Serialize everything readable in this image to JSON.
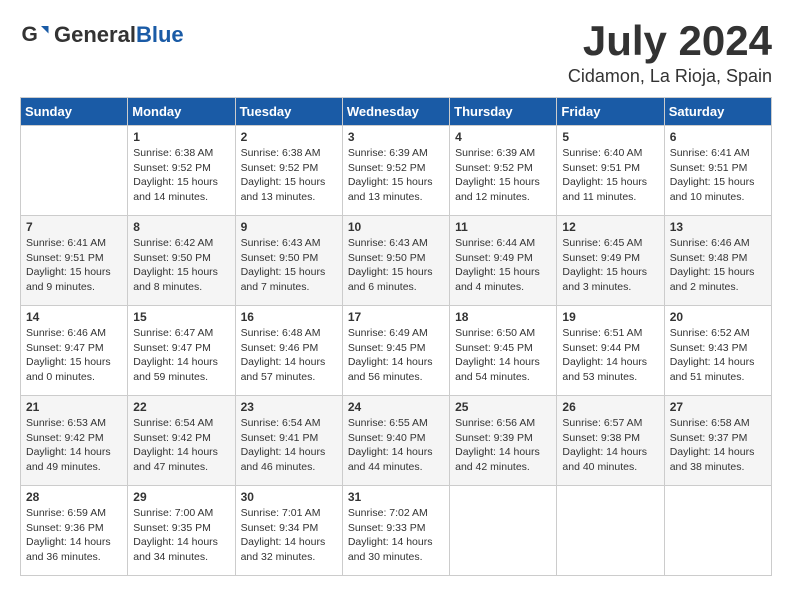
{
  "header": {
    "logo_general": "General",
    "logo_blue": "Blue",
    "month_year": "July 2024",
    "location": "Cidamon, La Rioja, Spain"
  },
  "days_of_week": [
    "Sunday",
    "Monday",
    "Tuesday",
    "Wednesday",
    "Thursday",
    "Friday",
    "Saturday"
  ],
  "weeks": [
    [
      {
        "day": "",
        "sunrise": "",
        "sunset": "",
        "daylight": ""
      },
      {
        "day": "1",
        "sunrise": "Sunrise: 6:38 AM",
        "sunset": "Sunset: 9:52 PM",
        "daylight": "Daylight: 15 hours and 14 minutes."
      },
      {
        "day": "2",
        "sunrise": "Sunrise: 6:38 AM",
        "sunset": "Sunset: 9:52 PM",
        "daylight": "Daylight: 15 hours and 13 minutes."
      },
      {
        "day": "3",
        "sunrise": "Sunrise: 6:39 AM",
        "sunset": "Sunset: 9:52 PM",
        "daylight": "Daylight: 15 hours and 13 minutes."
      },
      {
        "day": "4",
        "sunrise": "Sunrise: 6:39 AM",
        "sunset": "Sunset: 9:52 PM",
        "daylight": "Daylight: 15 hours and 12 minutes."
      },
      {
        "day": "5",
        "sunrise": "Sunrise: 6:40 AM",
        "sunset": "Sunset: 9:51 PM",
        "daylight": "Daylight: 15 hours and 11 minutes."
      },
      {
        "day": "6",
        "sunrise": "Sunrise: 6:41 AM",
        "sunset": "Sunset: 9:51 PM",
        "daylight": "Daylight: 15 hours and 10 minutes."
      }
    ],
    [
      {
        "day": "7",
        "sunrise": "Sunrise: 6:41 AM",
        "sunset": "Sunset: 9:51 PM",
        "daylight": "Daylight: 15 hours and 9 minutes."
      },
      {
        "day": "8",
        "sunrise": "Sunrise: 6:42 AM",
        "sunset": "Sunset: 9:50 PM",
        "daylight": "Daylight: 15 hours and 8 minutes."
      },
      {
        "day": "9",
        "sunrise": "Sunrise: 6:43 AM",
        "sunset": "Sunset: 9:50 PM",
        "daylight": "Daylight: 15 hours and 7 minutes."
      },
      {
        "day": "10",
        "sunrise": "Sunrise: 6:43 AM",
        "sunset": "Sunset: 9:50 PM",
        "daylight": "Daylight: 15 hours and 6 minutes."
      },
      {
        "day": "11",
        "sunrise": "Sunrise: 6:44 AM",
        "sunset": "Sunset: 9:49 PM",
        "daylight": "Daylight: 15 hours and 4 minutes."
      },
      {
        "day": "12",
        "sunrise": "Sunrise: 6:45 AM",
        "sunset": "Sunset: 9:49 PM",
        "daylight": "Daylight: 15 hours and 3 minutes."
      },
      {
        "day": "13",
        "sunrise": "Sunrise: 6:46 AM",
        "sunset": "Sunset: 9:48 PM",
        "daylight": "Daylight: 15 hours and 2 minutes."
      }
    ],
    [
      {
        "day": "14",
        "sunrise": "Sunrise: 6:46 AM",
        "sunset": "Sunset: 9:47 PM",
        "daylight": "Daylight: 15 hours and 0 minutes."
      },
      {
        "day": "15",
        "sunrise": "Sunrise: 6:47 AM",
        "sunset": "Sunset: 9:47 PM",
        "daylight": "Daylight: 14 hours and 59 minutes."
      },
      {
        "day": "16",
        "sunrise": "Sunrise: 6:48 AM",
        "sunset": "Sunset: 9:46 PM",
        "daylight": "Daylight: 14 hours and 57 minutes."
      },
      {
        "day": "17",
        "sunrise": "Sunrise: 6:49 AM",
        "sunset": "Sunset: 9:45 PM",
        "daylight": "Daylight: 14 hours and 56 minutes."
      },
      {
        "day": "18",
        "sunrise": "Sunrise: 6:50 AM",
        "sunset": "Sunset: 9:45 PM",
        "daylight": "Daylight: 14 hours and 54 minutes."
      },
      {
        "day": "19",
        "sunrise": "Sunrise: 6:51 AM",
        "sunset": "Sunset: 9:44 PM",
        "daylight": "Daylight: 14 hours and 53 minutes."
      },
      {
        "day": "20",
        "sunrise": "Sunrise: 6:52 AM",
        "sunset": "Sunset: 9:43 PM",
        "daylight": "Daylight: 14 hours and 51 minutes."
      }
    ],
    [
      {
        "day": "21",
        "sunrise": "Sunrise: 6:53 AM",
        "sunset": "Sunset: 9:42 PM",
        "daylight": "Daylight: 14 hours and 49 minutes."
      },
      {
        "day": "22",
        "sunrise": "Sunrise: 6:54 AM",
        "sunset": "Sunset: 9:42 PM",
        "daylight": "Daylight: 14 hours and 47 minutes."
      },
      {
        "day": "23",
        "sunrise": "Sunrise: 6:54 AM",
        "sunset": "Sunset: 9:41 PM",
        "daylight": "Daylight: 14 hours and 46 minutes."
      },
      {
        "day": "24",
        "sunrise": "Sunrise: 6:55 AM",
        "sunset": "Sunset: 9:40 PM",
        "daylight": "Daylight: 14 hours and 44 minutes."
      },
      {
        "day": "25",
        "sunrise": "Sunrise: 6:56 AM",
        "sunset": "Sunset: 9:39 PM",
        "daylight": "Daylight: 14 hours and 42 minutes."
      },
      {
        "day": "26",
        "sunrise": "Sunrise: 6:57 AM",
        "sunset": "Sunset: 9:38 PM",
        "daylight": "Daylight: 14 hours and 40 minutes."
      },
      {
        "day": "27",
        "sunrise": "Sunrise: 6:58 AM",
        "sunset": "Sunset: 9:37 PM",
        "daylight": "Daylight: 14 hours and 38 minutes."
      }
    ],
    [
      {
        "day": "28",
        "sunrise": "Sunrise: 6:59 AM",
        "sunset": "Sunset: 9:36 PM",
        "daylight": "Daylight: 14 hours and 36 minutes."
      },
      {
        "day": "29",
        "sunrise": "Sunrise: 7:00 AM",
        "sunset": "Sunset: 9:35 PM",
        "daylight": "Daylight: 14 hours and 34 minutes."
      },
      {
        "day": "30",
        "sunrise": "Sunrise: 7:01 AM",
        "sunset": "Sunset: 9:34 PM",
        "daylight": "Daylight: 14 hours and 32 minutes."
      },
      {
        "day": "31",
        "sunrise": "Sunrise: 7:02 AM",
        "sunset": "Sunset: 9:33 PM",
        "daylight": "Daylight: 14 hours and 30 minutes."
      },
      {
        "day": "",
        "sunrise": "",
        "sunset": "",
        "daylight": ""
      },
      {
        "day": "",
        "sunrise": "",
        "sunset": "",
        "daylight": ""
      },
      {
        "day": "",
        "sunrise": "",
        "sunset": "",
        "daylight": ""
      }
    ]
  ]
}
